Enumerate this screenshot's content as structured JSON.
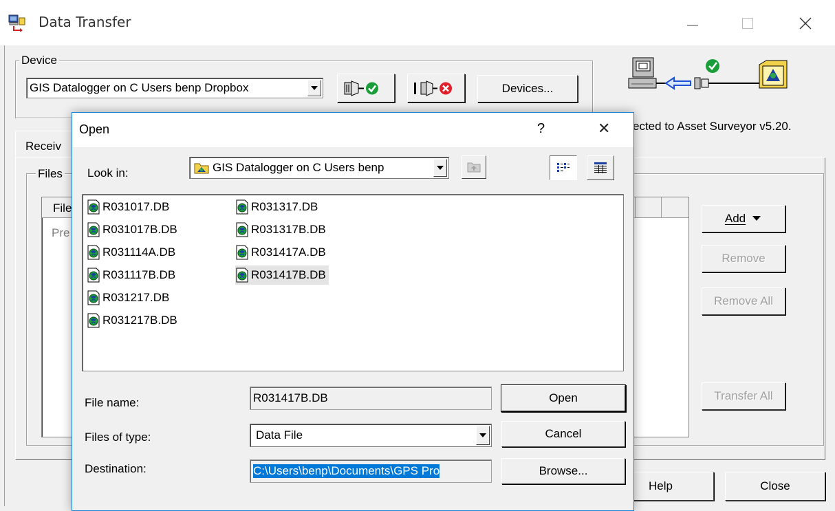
{
  "window": {
    "title": "Data Transfer"
  },
  "device": {
    "group_label": "Device",
    "selected": "GIS Datalogger on C  Users benp Dropbox",
    "devices_button": "Devices...",
    "status": "ected to Asset Surveyor v5.20."
  },
  "tabs": {
    "receive_partial": "Receiv"
  },
  "files_group": {
    "label_partial": "Files",
    "col_header_partial": "File",
    "row_partial": "Pre"
  },
  "side_buttons": {
    "add": "Add",
    "remove": "Remove",
    "remove_all": "Remove All",
    "transfer_all": "Transfer All"
  },
  "bottom_buttons": {
    "help": "Help",
    "close": "Close"
  },
  "open_dialog": {
    "title": "Open",
    "help_glyph": "?",
    "close_glyph": "✕",
    "look_in_label": "Look in:",
    "look_in_value": "GIS Datalogger on C  Users benp",
    "files": [
      "R031017.DB",
      "R031017B.DB",
      "R031114A.DB",
      "R031117B.DB",
      "R031217.DB",
      "R031217B.DB",
      "R031317.DB",
      "R031317B.DB",
      "R031417A.DB",
      "R031417B.DB"
    ],
    "selected_file": "R031417B.DB",
    "file_name_label": "File name:",
    "file_name_value": "R031417B.DB",
    "files_of_type_label": "Files of type:",
    "files_of_type_value": "Data File",
    "destination_label": "Destination:",
    "destination_value": "C:\\Users\\benp\\Documents\\GPS Pro",
    "open_button": "Open",
    "cancel_button": "Cancel",
    "browse_button": "Browse..."
  },
  "colors": {
    "accent": "#0078d7",
    "dialog_border": "#1883d7",
    "ok_green": "#1a9e3a",
    "error_red": "#e0202a"
  }
}
